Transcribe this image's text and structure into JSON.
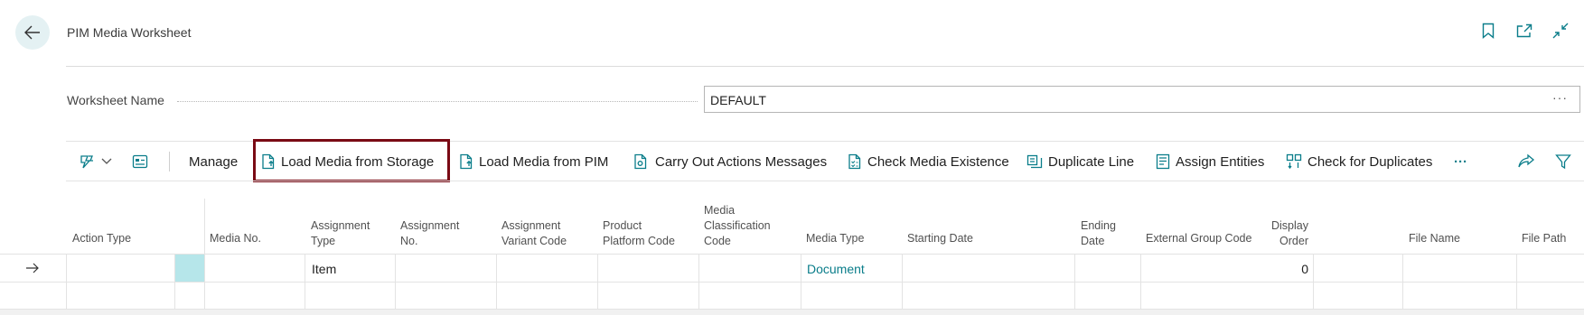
{
  "page": {
    "title": "PIM Media Worksheet"
  },
  "header_icons": [
    "bookmark-icon",
    "open-new-window-icon",
    "collapse-icon"
  ],
  "worksheet": {
    "label": "Worksheet Name",
    "value": "DEFAULT",
    "lookup": "···"
  },
  "toolbar": {
    "manage": "Manage",
    "load_storage": "Load Media from Storage",
    "load_pim": "Load Media from PIM",
    "carry_out": "Carry Out Actions Messages",
    "check_existence": "Check Media Existence",
    "duplicate_line": "Duplicate Line",
    "assign_entities": "Assign Entities",
    "check_duplicates": "Check for Duplicates",
    "more": "···"
  },
  "columns": {
    "action_type": "Action Type",
    "media_no": "Media No.",
    "assignment_type_1": "Assignment",
    "assignment_type_2": "Type",
    "assignment_no_1": "Assignment",
    "assignment_no_2": "No.",
    "assignment_variant_1": "Assignment",
    "assignment_variant_2": "Variant Code",
    "product_platform_1": "Product",
    "product_platform_2": "Platform Code",
    "media_class_1": "Media",
    "media_class_2": "Classification",
    "media_class_3": "Code",
    "media_type": "Media Type",
    "starting_date": "Starting Date",
    "ending_date_1": "Ending",
    "ending_date_2": "Date",
    "external_group": "External Group Code",
    "display_order_1": "Display",
    "display_order_2": "Order",
    "file_name": "File Name",
    "file_path": "File Path"
  },
  "row": {
    "assignment_type": "Item",
    "media_type": "Document",
    "display_order": "0"
  },
  "colors": {
    "accent": "#0a7d8a",
    "highlight_border": "#7a0a14",
    "selected_cell": "#b6e6ea"
  }
}
